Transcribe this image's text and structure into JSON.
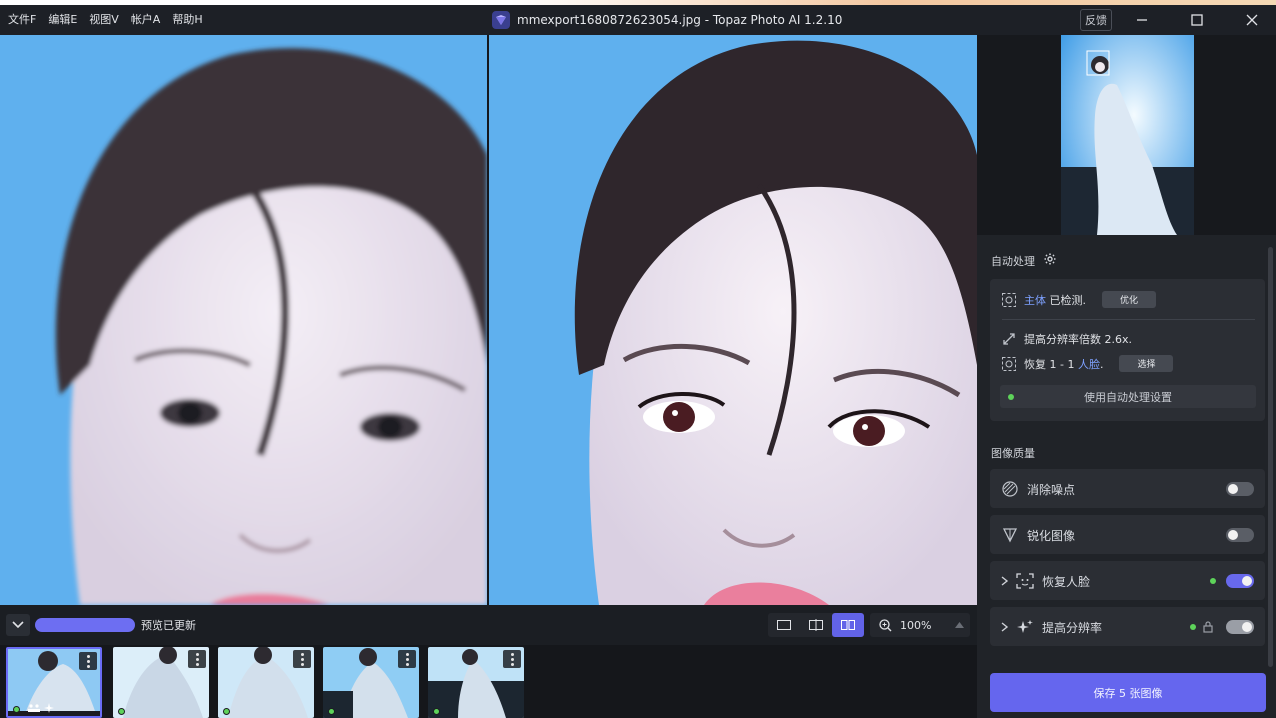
{
  "menu": [
    "文件F",
    "编辑E",
    "视图V",
    "帐户A",
    "帮助H"
  ],
  "window": {
    "title": "mmexport1680872623054.jpg - Topaz Photo AI 1.2.10",
    "feedback_label": "反馈"
  },
  "bottombar": {
    "preview_status": "预览已更新",
    "zoom_value": "100%"
  },
  "sidebar": {
    "auto_title": "自动处理",
    "detect": {
      "subject": "主体",
      "detected": " 已检测.",
      "optimize_label": "优化"
    },
    "upscale_text": "提高分辨率倍数 2.6x.",
    "face": {
      "prefix": "恢复 1 - 1 ",
      "face_link": "人脸",
      "suffix": ".",
      "select_label": "选择"
    },
    "use_auto_label": "使用自动处理设置",
    "quality_title": "图像质量",
    "tools": [
      {
        "label": "消除噪点",
        "enabled": false
      },
      {
        "label": "锐化图像",
        "enabled": false
      },
      {
        "label": "恢复人脸",
        "enabled": true
      },
      {
        "label": "提高分辨率",
        "enabled": true
      }
    ],
    "save_label": "保存 5 张图像"
  },
  "colors": {
    "accent": "#6566ee",
    "status_green": "#5ed35a",
    "background": "#1a1d22"
  }
}
